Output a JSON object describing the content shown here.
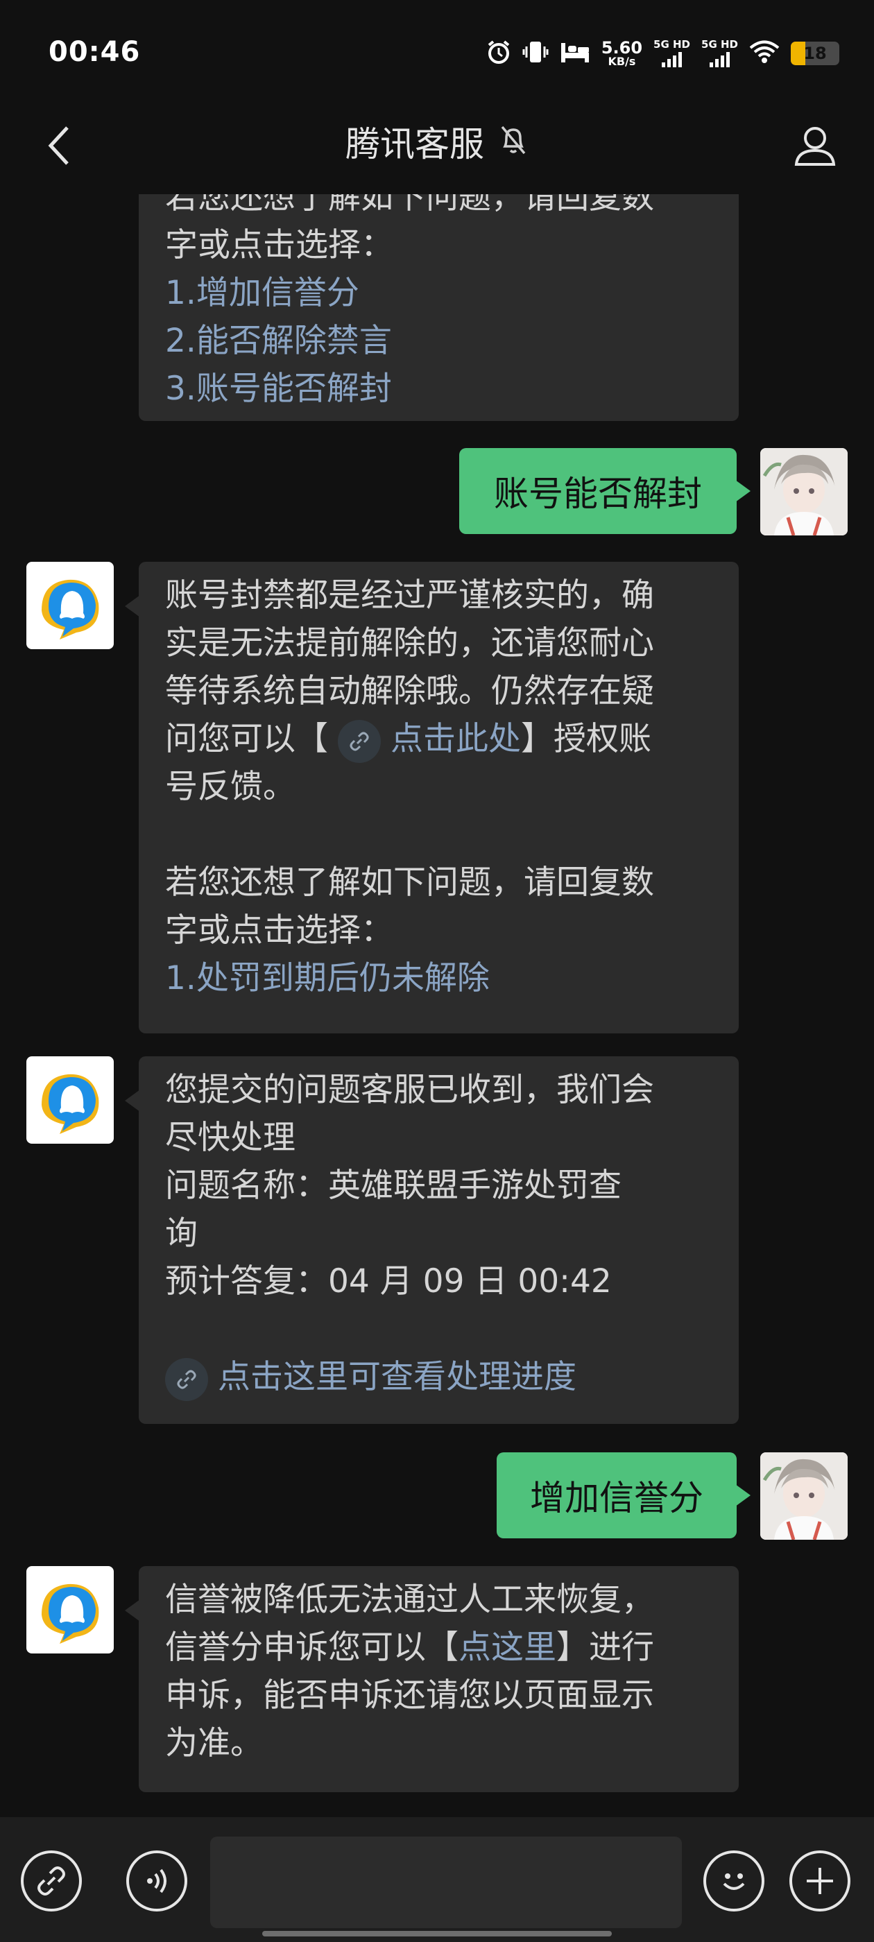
{
  "status_bar": {
    "time": "00:46",
    "speed_value": "5.60",
    "speed_unit": "KB/s",
    "net1_label": "5G HD",
    "net2_label": "5G HD",
    "battery_level": "18"
  },
  "header": {
    "title": "腾讯客服"
  },
  "messages": [
    {
      "lines": [
        "若您还想了解如下问题，请回复数",
        "字或点击选择："
      ],
      "options": [
        "1.增加信誉分",
        "2.能否解除禁言",
        "3.账号能否解封"
      ]
    },
    {
      "text": "账号能否解封"
    },
    {
      "lines": [
        "账号封禁都是经过严谨核实的，确",
        "实是无法提前解除的，还请您耐心",
        "等待系统自动解除哦。仍然存在疑"
      ],
      "line4_prefix": "问您可以【",
      "line4_link": "点击此处",
      "line4_suffix": "】授权账",
      "line5": "号反馈。",
      "lines2": [
        "若您还想了解如下问题，请回复数",
        "字或点击选择："
      ],
      "options": [
        "1.处罚到期后仍未解除"
      ]
    },
    {
      "lines": [
        "您提交的问题客服已收到，我们会",
        "尽快处理",
        "问题名称：英雄联盟手游处罚查",
        "询",
        "预计答复：04 月 09 日 00:42"
      ],
      "link": "点击这里可查看处理进度"
    },
    {
      "text": "增加信誉分"
    },
    {
      "line1": "信誉被降低无法通过人工来恢复，",
      "line2_prefix": "信誉分申诉您可以【",
      "line2_link": "点这里",
      "line2_suffix": "】进行",
      "lines": [
        "申诉，能否申诉还请您以页面显示",
        "为准。"
      ]
    }
  ],
  "input": {
    "placeholder": ""
  }
}
